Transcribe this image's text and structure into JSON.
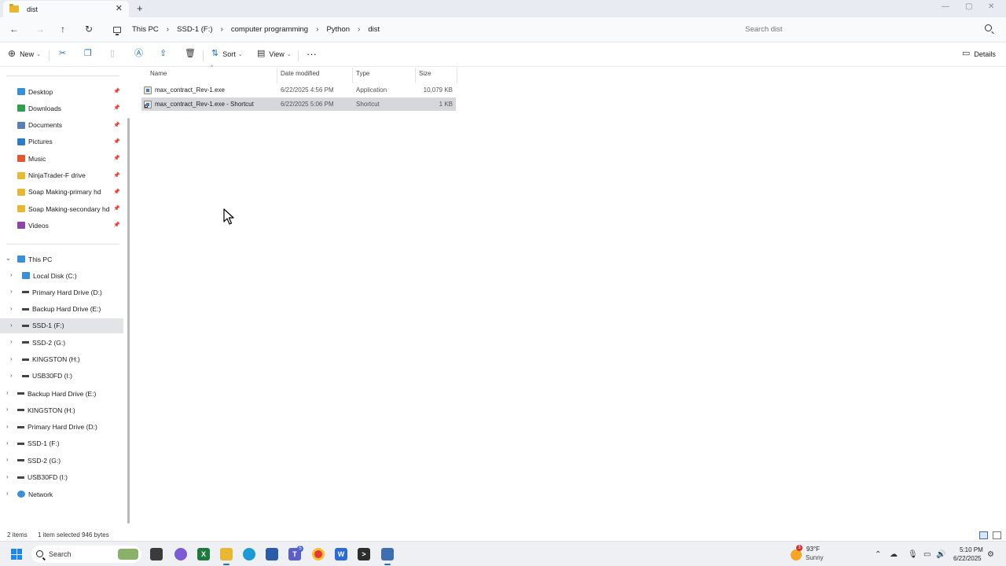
{
  "tab": {
    "title": "dist"
  },
  "breadcrumb": [
    "This PC",
    "SSD-1 (F:)",
    "computer programming",
    "Python",
    "dist"
  ],
  "search": {
    "placeholder": "Search dist"
  },
  "commandbar": {
    "new_label": "New",
    "sort_label": "Sort",
    "view_label": "View",
    "details_label": "Details"
  },
  "sidebar": {
    "quick_access": [
      {
        "label": "Desktop",
        "icon": "desktop-icon",
        "color": "#3a8fd9"
      },
      {
        "label": "Downloads",
        "icon": "downloads-icon",
        "color": "#2e9e4f"
      },
      {
        "label": "Documents",
        "icon": "documents-icon",
        "color": "#5a7fb5"
      },
      {
        "label": "Pictures",
        "icon": "pictures-icon",
        "color": "#2c7cc7"
      },
      {
        "label": "Music",
        "icon": "music-icon",
        "color": "#e4572e"
      },
      {
        "label": "NinjaTrader-F drive",
        "icon": "folder-icon",
        "color": "#e8b830"
      },
      {
        "label": "Soap Making-primary hd",
        "icon": "folder-icon",
        "color": "#e8b830"
      },
      {
        "label": "Soap Making-secondary hd",
        "icon": "folder-icon",
        "color": "#e8b830"
      },
      {
        "label": "Videos",
        "icon": "videos-icon",
        "color": "#8e44ad"
      }
    ],
    "this_pc": "This PC",
    "this_pc_children": [
      "Local Disk (C:)",
      "Primary Hard Drive (D:)",
      "Backup Hard Drive (E:)",
      "SSD-1 (F:)",
      "SSD-2 (G:)",
      "KINGSTON (H:)",
      "USB30FD (I:)"
    ],
    "drives": [
      "Backup Hard Drive (E:)",
      "KINGSTON (H:)",
      "Primary Hard Drive (D:)",
      "SSD-1 (F:)",
      "SSD-2 (G:)",
      "USB30FD (I:)"
    ],
    "network": "Network"
  },
  "filelist": {
    "columns": {
      "name": "Name",
      "date": "Date modified",
      "type": "Type",
      "size": "Size"
    },
    "rows": [
      {
        "name": "max_contract_Rev-1.exe",
        "date": "6/22/2025 4:56 PM",
        "type": "Application",
        "size": "10,079 KB"
      },
      {
        "name": "max_contract_Rev-1.exe - Shortcut",
        "date": "6/22/2025 5:06 PM",
        "type": "Shortcut",
        "size": "1 KB"
      }
    ]
  },
  "status": {
    "items": "2 items",
    "selected": "1 item selected  946 bytes"
  },
  "taskbar": {
    "search_label": "Search",
    "weather_temp": "93°F",
    "weather_desc": "Sunny",
    "weather_badge": "3",
    "teams_badge": "5",
    "time": "5:10 PM",
    "date": "6/22/2025"
  }
}
